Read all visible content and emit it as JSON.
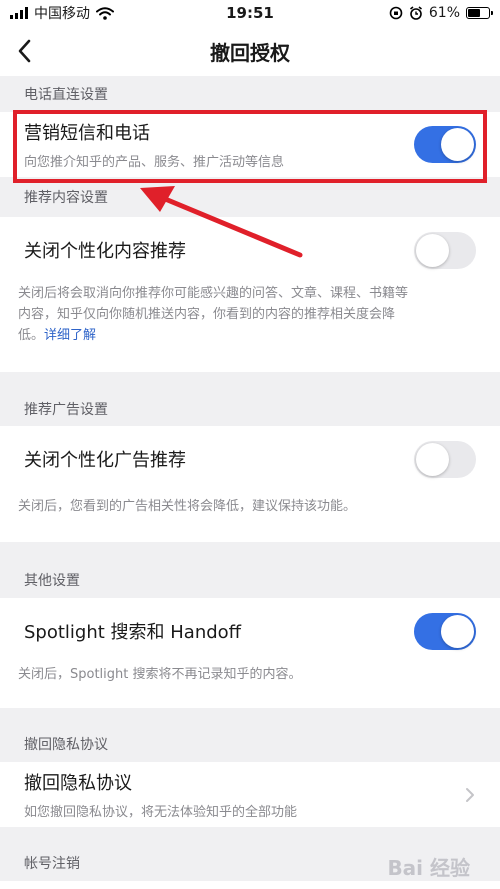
{
  "status_bar": {
    "carrier": "中国移动",
    "time": "19:51",
    "battery": "61%",
    "battery_level": 0.61
  },
  "nav": {
    "title": "撤回授权"
  },
  "sections": {
    "phone": {
      "header": "电话直连设置",
      "title": "营销短信和电话",
      "subtitle": "向您推介知乎的产品、服务、推广活动等信息",
      "enabled": true
    },
    "content": {
      "header": "推荐内容设置",
      "title": "关闭个性化内容推荐",
      "desc_line1": "关闭后将会取消向你推荐你可能感兴趣的问答、文章、课程、书籍等",
      "desc_line2": "内容，知乎仅向你随机推送内容，你看到的内容的推荐相关度会降",
      "desc_line3": "低。",
      "link": "详细了解",
      "enabled": false
    },
    "ads": {
      "header": "推荐广告设置",
      "title": "关闭个性化广告推荐",
      "desc": "关闭后，您看到的广告相关性将会降低，建议保持该功能。",
      "enabled": false
    },
    "other": {
      "header": "其他设置",
      "title": "Spotlight 搜索和 Handoff",
      "desc": "关闭后，Spotlight 搜索将不再记录知乎的内容。",
      "enabled": true
    },
    "privacy": {
      "header": "撤回隐私协议",
      "title": "撤回隐私协议",
      "subtitle": "如您撤回隐私协议，将无法体验知乎的全部功能"
    },
    "account": {
      "header": "帐号注销"
    }
  },
  "watermark": "Bai 经验",
  "colors": {
    "accent": "#3470e4",
    "highlight": "#e0202a",
    "link": "#2e63c8"
  }
}
